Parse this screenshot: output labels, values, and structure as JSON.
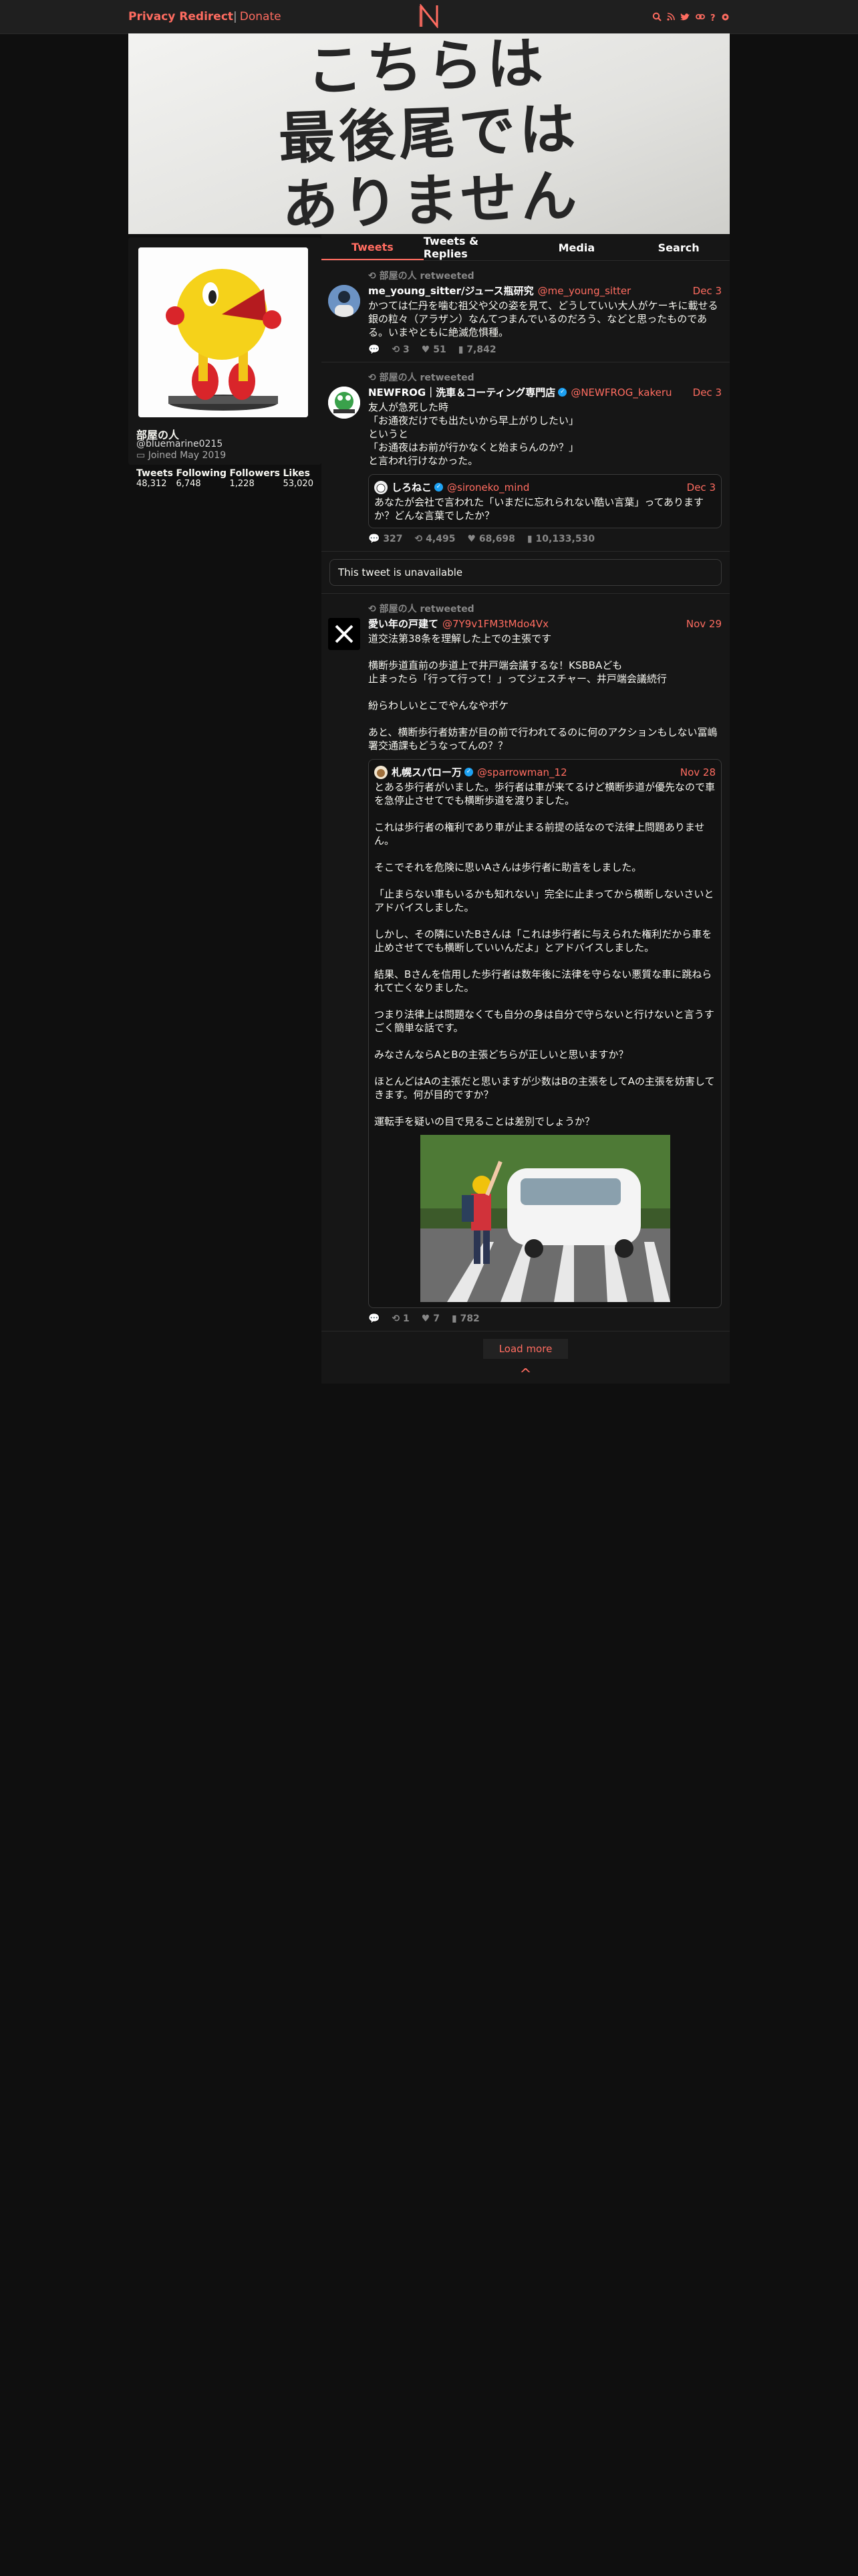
{
  "nav": {
    "brand": "Privacy Redirect",
    "sep": "|",
    "donate": "Donate",
    "icons": [
      "search-icon",
      "rss-icon",
      "twitter-icon",
      "link-icon",
      "info-icon",
      "gear-icon"
    ]
  },
  "banner": {
    "lines": [
      "こちらは",
      "最後尾では",
      "ありません"
    ]
  },
  "profile": {
    "name": "部屋の人",
    "username": "@bluemarine0215",
    "joined": "Joined May 2019",
    "stats": [
      {
        "label": "Tweets",
        "value": "48,312"
      },
      {
        "label": "Following",
        "value": "6,748"
      },
      {
        "label": "Followers",
        "value": "1,228"
      },
      {
        "label": "Likes",
        "value": "53,020"
      }
    ]
  },
  "tabs": [
    "Tweets",
    "Tweets & Replies",
    "Media",
    "Search"
  ],
  "tweets": [
    {
      "retweet": "部屋の人 retweeted",
      "fullname": "me_young_sitter/ジュース瓶研究",
      "handle": "@me_young_sitter",
      "date": "Dec 3",
      "body": "かつては仁丹を噛む祖父や父の姿を見て、どうしていい大人がケーキに載せる銀の粒々（アラザン）なんてつまんでいるのだろう、などと思ったものである。いまやともに絶滅危惧種。",
      "stats": {
        "replies": "",
        "retweets": "3",
        "likes": "51",
        "views": "7,842"
      }
    },
    {
      "retweet": "部屋の人 retweeted",
      "fullname": "NEWFROG｜洗車＆コーティング専門店",
      "handle": "@NEWFROG_kakeru",
      "date": "Dec 3",
      "body": "友人が急死した時\n「お通夜だけでも出たいから早上がりしたい」\nというと\n「お通夜はお前が行かなくと始まらんのか？」\nと言われ行けなかった。",
      "quote": {
        "fullname": "しろねこ",
        "handle": "@sironeko_mind",
        "date": "Dec 3",
        "body": "あなたが会社で言われた「いまだに忘れられない酷い言葉」ってありますか？どんな言葉でしたか？"
      },
      "stats": {
        "replies": "327",
        "retweets": "4,495",
        "likes": "68,698",
        "views": "10,133,530"
      }
    },
    {
      "unavailable": "This tweet is unavailable"
    },
    {
      "retweet": "部屋の人 retweeted",
      "fullname": "愛い年の戸建て",
      "handle": "@7Y9v1FM3tMdo4Vx",
      "date": "Nov 29",
      "body": "道交法第38条を理解した上での主張です\n\n横断歩道直前の歩道上で井戸端会議するな！KSBBAども\n止まったら「行って行って！」ってジェスチャー、井戸端会議続行\n\n紛らわしいとこでやんなやボケ\n\nあと、横断歩行者妨害が目の前で行われてるのに何のアクションもしない冨嶋署交通課もどうなってんの？？",
      "quote": {
        "fullname": "札幌スパロー万",
        "handle": "@sparrowman_12",
        "date": "Nov 28",
        "body": "とある歩行者がいました。歩行者は車が来てるけど横断歩道が優先なので車を急停止させてでも横断歩道を渡りました。\n\nこれは歩行者の権利であり車が止まる前提の話なので法律上問題ありません。\n\nそこでそれを危険に思いAさんは歩行者に助言をしました。\n\n「止まらない車もいるかも知れない」完全に止まってから横断しないさいとアドバイスしました。\n\nしかし、その隣にいたBさんは「これは歩行者に与えられた権利だから車を止めさせてでも横断していいんだよ」とアドバイスしました。\n\n結果、Bさんを信用した歩行者は数年後に法律を守らない悪質な車に跳ねられて亡くなりました。\n\nつまり法律上は問題なくても自分の身は自分で守らないと行けないと言うすごく簡単な話です。\n\nみなさんならAとBの主張どちらが正しいと思いますか？\n\nほとんどはAの主張だと思いますが少数はBの主張をしてAの主張を妨害してきます。何が目的ですか？\n\n運転手を疑いの目で見ることは差別でしょうか？"
      },
      "stats": {
        "replies": "",
        "retweets": "1",
        "likes": "7",
        "views": "782"
      }
    }
  ],
  "load_more": "Load more",
  "top_arrow": "^",
  "colors": {
    "accent": "#ff6c60",
    "bg": "#0f0f0f",
    "panel": "#161616"
  }
}
